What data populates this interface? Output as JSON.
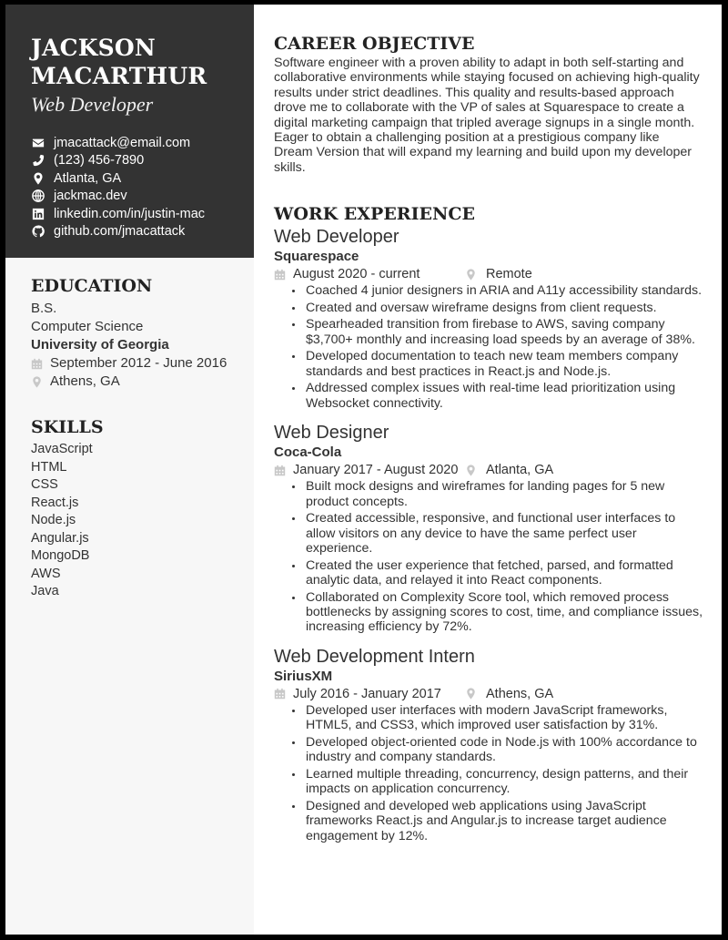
{
  "person": {
    "name_line1": "JACKSON",
    "name_line2": "MACARTHUR",
    "title": "Web Developer"
  },
  "contacts": [
    {
      "icon": "envelope-icon",
      "text": "jmacattack@email.com"
    },
    {
      "icon": "phone-icon",
      "text": "(123) 456-7890"
    },
    {
      "icon": "map-pin-icon",
      "text": "Atlanta, GA"
    },
    {
      "icon": "globe-icon",
      "text": "jackmac.dev"
    },
    {
      "icon": "linkedin-icon",
      "text": "linkedin.com/in/justin-mac"
    },
    {
      "icon": "github-icon",
      "text": "github.com/jmacattack"
    }
  ],
  "education": {
    "heading": "EDUCATION",
    "degree": "B.S.",
    "field": "Computer Science",
    "school": "University of Georgia",
    "dates": "September 2012 - June 2016",
    "location": "Athens, GA"
  },
  "skills": {
    "heading": "SKILLS",
    "items": [
      "JavaScript",
      "HTML",
      "CSS",
      "React.js",
      "Node.js",
      "Angular.js",
      "MongoDB",
      "AWS",
      "Java"
    ]
  },
  "objective": {
    "heading": "CAREER OBJECTIVE",
    "text": "Software engineer with a proven ability to adapt in both self-starting and collaborative environments while staying focused on achieving high-quality results under strict deadlines. This quality and results-based approach drove me to collaborate with the VP of sales at Squarespace to create a digital marketing campaign that tripled average signups in a single month. Eager to obtain a challenging position at a prestigious company like Dream Version that will expand my learning and build upon my developer skills."
  },
  "work": {
    "heading": "WORK EXPERIENCE",
    "jobs": [
      {
        "title": "Web Developer",
        "company": "Squarespace",
        "dates": "August 2020 - current",
        "location": "Remote",
        "bullets": [
          "Coached 4 junior designers in ARIA and A11y accessibility standards.",
          "Created and oversaw wireframe designs from client requests.",
          "Spearheaded transition from firebase to AWS, saving company $3,700+ monthly and increasing load speeds by an average of 38%.",
          "Developed documentation to teach new team members company standards and best practices in React.js and Node.js.",
          "Addressed complex issues with real-time lead prioritization using Websocket connectivity."
        ]
      },
      {
        "title": "Web Designer",
        "company": "Coca-Cola",
        "dates": "January 2017 - August 2020",
        "location": "Atlanta, GA",
        "bullets": [
          "Built mock designs and wireframes for landing pages for 5 new product concepts.",
          "Created accessible, responsive, and functional user interfaces to allow visitors on any device to have the same perfect user experience.",
          "Created the user experience that fetched, parsed, and formatted analytic data, and relayed it into React components.",
          "Collaborated on Complexity Score tool, which removed process bottlenecks by assigning scores to cost, time, and compliance issues, increasing efficiency by 72%."
        ]
      },
      {
        "title": "Web Development Intern",
        "company": "SiriusXM",
        "dates": "July 2016 - January 2017",
        "location": "Athens, GA",
        "bullets": [
          "Developed user interfaces with modern JavaScript frameworks, HTML5, and CSS3, which improved user satisfaction by 31%.",
          "Developed object-oriented code in Node.js with 100% accordance to industry and company standards.",
          "Learned multiple threading, concurrency, design patterns, and their impacts on application concurrency.",
          "Designed and developed web applications using JavaScript frameworks React.js and Angular.js to increase target audience engagement by 12%."
        ]
      }
    ]
  }
}
